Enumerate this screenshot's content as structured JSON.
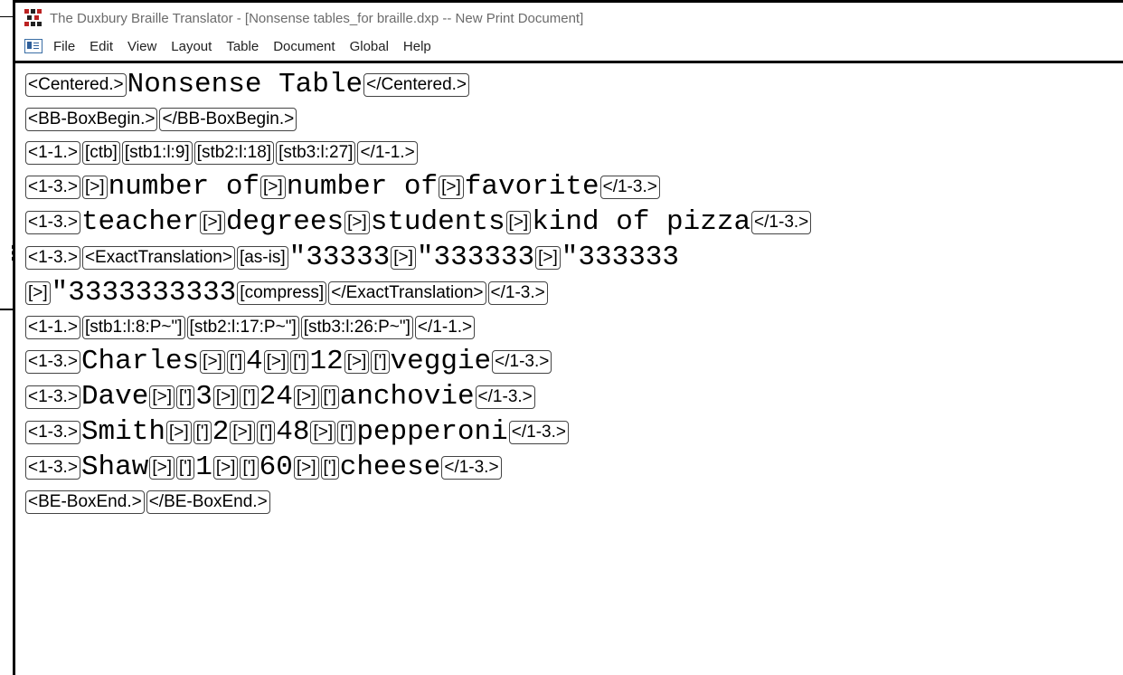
{
  "window": {
    "title": "The Duxbury Braille Translator - [Nonsense tables_for braille.dxp -- New Print Document]"
  },
  "menu": [
    "File",
    "Edit",
    "View",
    "Layout",
    "Table",
    "Document",
    "Global",
    "Help"
  ],
  "document": {
    "lines": [
      [
        {
          "t": "tag",
          "v": "<Centered.>"
        },
        {
          "t": "txt",
          "v": "Nonsense Table"
        },
        {
          "t": "tag",
          "v": "</Centered.>"
        }
      ],
      [
        {
          "t": "tag",
          "v": "<BB-BoxBegin.>"
        },
        {
          "t": "tag",
          "v": "</BB-BoxBegin.>"
        }
      ],
      [
        {
          "t": "tag",
          "v": "<1-1.>"
        },
        {
          "t": "tag",
          "v": "[ctb]"
        },
        {
          "t": "tag",
          "v": "[stb1:l:9]"
        },
        {
          "t": "tag",
          "v": "[stb2:l:18]"
        },
        {
          "t": "tag",
          "v": "[stb3:l:27]"
        },
        {
          "t": "tag",
          "v": "</1-1.>"
        }
      ],
      [
        {
          "t": "tag",
          "v": "<1-3.>"
        },
        {
          "t": "tag",
          "v": "[>]"
        },
        {
          "t": "txt",
          "v": "number of"
        },
        {
          "t": "tag",
          "v": "[>]"
        },
        {
          "t": "txt",
          "v": "number of"
        },
        {
          "t": "tag",
          "v": "[>]"
        },
        {
          "t": "txt",
          "v": "favorite"
        },
        {
          "t": "tag",
          "v": "</1-3.>"
        }
      ],
      [
        {
          "t": "tag",
          "v": "<1-3.>"
        },
        {
          "t": "txt",
          "v": "teacher"
        },
        {
          "t": "tag",
          "v": "[>]"
        },
        {
          "t": "txt",
          "v": "degrees"
        },
        {
          "t": "tag",
          "v": "[>]"
        },
        {
          "t": "txt",
          "v": "students"
        },
        {
          "t": "tag",
          "v": "[>]"
        },
        {
          "t": "txt",
          "v": "kind of pizza"
        },
        {
          "t": "tag",
          "v": "</1-3.>"
        }
      ],
      [
        {
          "t": "tag",
          "v": "<1-3.>"
        },
        {
          "t": "tag",
          "v": "<ExactTranslation>"
        },
        {
          "t": "tag",
          "v": "[as-is]"
        },
        {
          "t": "txt",
          "v": "\"33333"
        },
        {
          "t": "tag",
          "v": "[>]"
        },
        {
          "t": "txt",
          "v": "\"333333"
        },
        {
          "t": "tag",
          "v": "[>]"
        },
        {
          "t": "txt",
          "v": "\"333333"
        }
      ],
      [
        {
          "t": "tag",
          "v": "[>]"
        },
        {
          "t": "txt",
          "v": "\"3333333333"
        },
        {
          "t": "tag",
          "v": "[compress]"
        },
        {
          "t": "tag",
          "v": "</ExactTranslation>"
        },
        {
          "t": "tag",
          "v": "</1-3.>"
        }
      ],
      [
        {
          "t": "tag",
          "v": "<1-1.>"
        },
        {
          "t": "tag",
          "v": "[stb1:l:8:P~\"]"
        },
        {
          "t": "tag",
          "v": "[stb2:l:17:P~\"]"
        },
        {
          "t": "tag",
          "v": "[stb3:l:26:P~\"]"
        },
        {
          "t": "tag",
          "v": "</1-1.>"
        }
      ],
      [
        {
          "t": "tag",
          "v": "<1-3.>"
        },
        {
          "t": "txt",
          "v": "Charles"
        },
        {
          "t": "tag",
          "v": "[>]"
        },
        {
          "t": "tag",
          "v": "[']"
        },
        {
          "t": "txt",
          "v": "4"
        },
        {
          "t": "tag",
          "v": "[>]"
        },
        {
          "t": "tag",
          "v": "[']"
        },
        {
          "t": "txt",
          "v": "12"
        },
        {
          "t": "tag",
          "v": "[>]"
        },
        {
          "t": "tag",
          "v": "[']"
        },
        {
          "t": "txt",
          "v": "veggie"
        },
        {
          "t": "tag",
          "v": "</1-3.>"
        }
      ],
      [
        {
          "t": "tag",
          "v": "<1-3.>"
        },
        {
          "t": "txt",
          "v": "Dave"
        },
        {
          "t": "tag",
          "v": "[>]"
        },
        {
          "t": "tag",
          "v": "[']"
        },
        {
          "t": "txt",
          "v": "3"
        },
        {
          "t": "tag",
          "v": "[>]"
        },
        {
          "t": "tag",
          "v": "[']"
        },
        {
          "t": "txt",
          "v": "24"
        },
        {
          "t": "tag",
          "v": "[>]"
        },
        {
          "t": "tag",
          "v": "[']"
        },
        {
          "t": "txt",
          "v": "anchovie"
        },
        {
          "t": "tag",
          "v": "</1-3.>"
        }
      ],
      [
        {
          "t": "tag",
          "v": "<1-3.>"
        },
        {
          "t": "txt",
          "v": "Smith"
        },
        {
          "t": "tag",
          "v": "[>]"
        },
        {
          "t": "tag",
          "v": "[']"
        },
        {
          "t": "txt",
          "v": "2"
        },
        {
          "t": "tag",
          "v": "[>]"
        },
        {
          "t": "tag",
          "v": "[']"
        },
        {
          "t": "txt",
          "v": "48"
        },
        {
          "t": "tag",
          "v": "[>]"
        },
        {
          "t": "tag",
          "v": "[']"
        },
        {
          "t": "txt",
          "v": "pepperoni"
        },
        {
          "t": "tag",
          "v": "</1-3.>"
        }
      ],
      [
        {
          "t": "tag",
          "v": "<1-3.>"
        },
        {
          "t": "txt",
          "v": "Shaw"
        },
        {
          "t": "tag",
          "v": "[>]"
        },
        {
          "t": "tag",
          "v": "[']"
        },
        {
          "t": "txt",
          "v": "1"
        },
        {
          "t": "tag",
          "v": "[>]"
        },
        {
          "t": "tag",
          "v": "[']"
        },
        {
          "t": "txt",
          "v": "60"
        },
        {
          "t": "tag",
          "v": "[>]"
        },
        {
          "t": "tag",
          "v": "[']"
        },
        {
          "t": "txt",
          "v": "cheese"
        },
        {
          "t": "tag",
          "v": "</1-3.>"
        }
      ],
      [
        {
          "t": "tag",
          "v": "<BE-BoxEnd.>"
        },
        {
          "t": "tag",
          "v": "</BE-BoxEnd.>"
        }
      ]
    ]
  },
  "icons": {
    "app": "duxbury-app-icon",
    "document": "document-icon"
  }
}
